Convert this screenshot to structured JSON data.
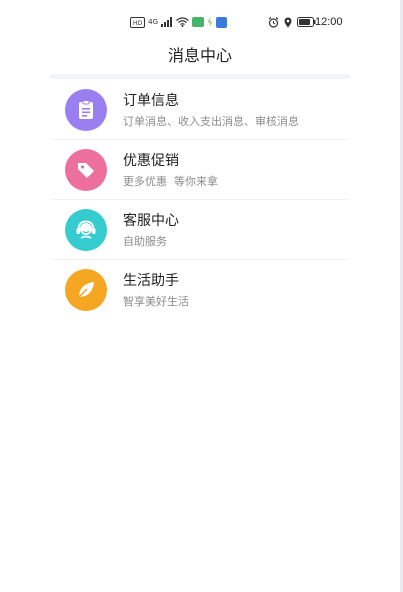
{
  "status_bar": {
    "hd_label": "HD",
    "net_label": "4G",
    "time": "12:00"
  },
  "header": {
    "title": "消息中心"
  },
  "colors": {
    "order": "#9a7ff0",
    "promo": "#ec6f9c",
    "service": "#35ccd0",
    "life": "#f5a623"
  },
  "items": [
    {
      "title": "订单信息",
      "subtitle": "订单消息、收入支出消息、审核消息",
      "icon": "clipboard-icon"
    },
    {
      "title": "优惠促销",
      "subtitle": "更多优惠  等你来拿",
      "icon": "tag-icon"
    },
    {
      "title": "客服中心",
      "subtitle": "自助服务",
      "icon": "headset-icon"
    },
    {
      "title": "生活助手",
      "subtitle": "智享美好生活",
      "icon": "leaf-icon"
    }
  ]
}
